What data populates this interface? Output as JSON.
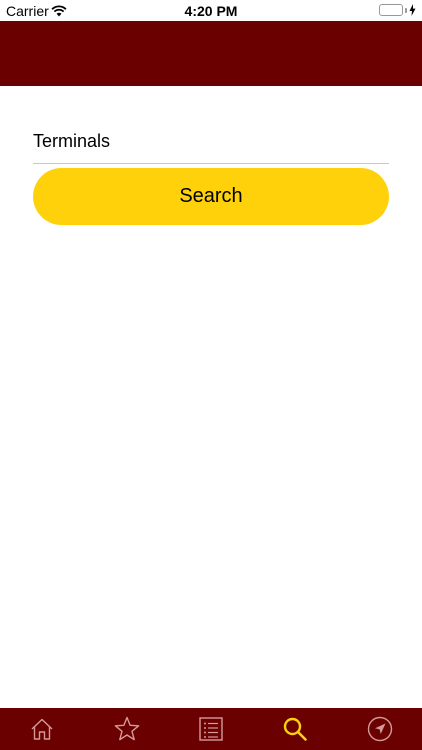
{
  "status_bar": {
    "carrier": "Carrier",
    "time": "4:20 PM",
    "battery_level": 1.0,
    "battery_color": "#4cd964"
  },
  "header": {
    "background_color": "#6b0000"
  },
  "search_form": {
    "field_placeholder": "Terminals",
    "field_value": "",
    "button_label": "Search",
    "button_color": "#fed10a"
  },
  "tab_bar": {
    "background_color": "#6b0000",
    "inactive_icon_color": "#d49a9a",
    "active_icon_color": "#fed10a",
    "selected_tab": "search",
    "tabs": [
      {
        "icon": "home-icon"
      },
      {
        "icon": "star-icon"
      },
      {
        "icon": "list-icon"
      },
      {
        "icon": "search-icon"
      },
      {
        "icon": "location-arrow-icon"
      }
    ]
  }
}
